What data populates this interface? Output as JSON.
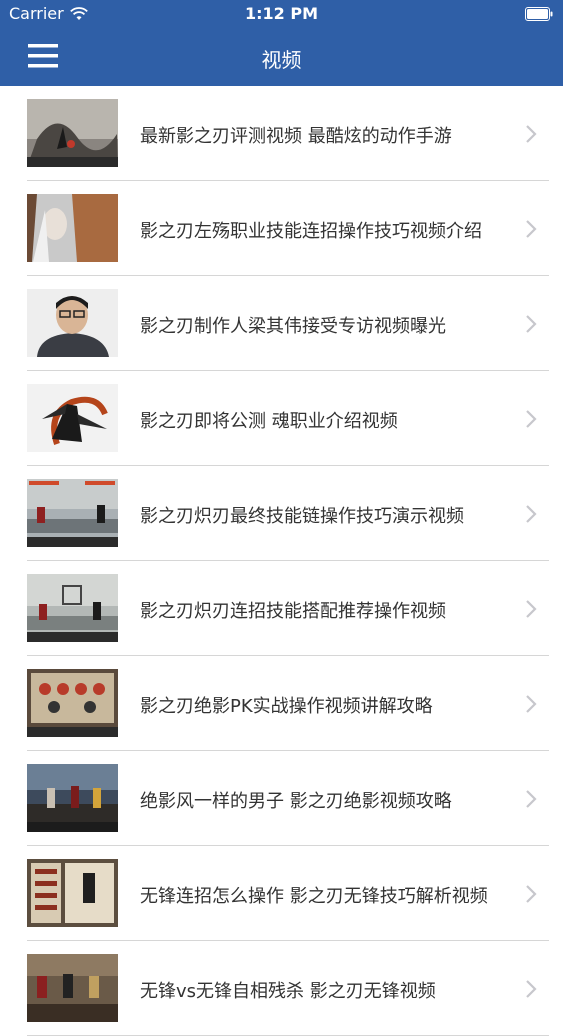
{
  "status_bar": {
    "carrier": "Carrier",
    "time": "1:12 PM",
    "wifi_icon": "wifi-icon",
    "battery_icon": "battery-icon"
  },
  "nav": {
    "menu_icon": "hamburger-menu-icon",
    "title": "视频"
  },
  "colors": {
    "nav_background": "#2f5fa7",
    "text": "#333333",
    "separator": "#d6d6d6",
    "chevron": "#c7c7cc"
  },
  "videos": [
    {
      "title": "最新影之刃评测视频 最酷炫的动作手游"
    },
    {
      "title": "影之刃左殇职业技能连招操作技巧视频介绍"
    },
    {
      "title": "影之刃制作人梁其伟接受专访视频曝光"
    },
    {
      "title": "影之刃即将公测 魂职业介绍视频"
    },
    {
      "title": "影之刃炽刃最终技能链操作技巧演示视频"
    },
    {
      "title": "影之刃炽刃连招技能搭配推荐操作视频"
    },
    {
      "title": "影之刃绝影PK实战操作视频讲解攻略"
    },
    {
      "title": "绝影风一样的男子 影之刃绝影视频攻略"
    },
    {
      "title": "无锋连招怎么操作 影之刃无锋技巧解析视频"
    },
    {
      "title": "无锋vs无锋自相残杀 影之刃无锋视频"
    }
  ]
}
